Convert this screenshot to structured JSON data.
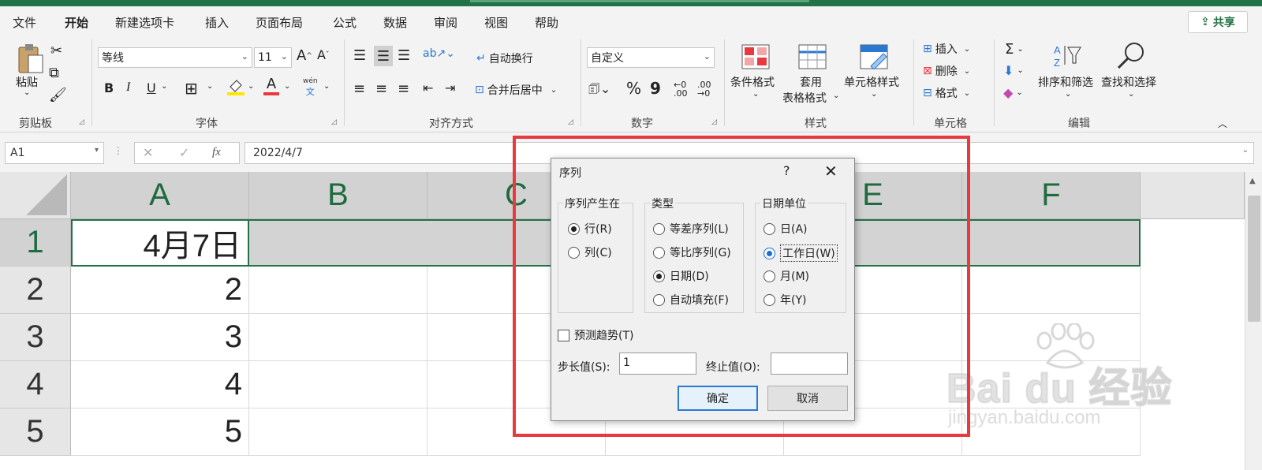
{
  "menu": {
    "items": [
      "文件",
      "开始",
      "新建选项卡",
      "插入",
      "页面布局",
      "公式",
      "数据",
      "审阅",
      "视图",
      "帮助"
    ],
    "share_label": "共享"
  },
  "ribbon": {
    "clipboard": {
      "paste": "粘贴",
      "group": "剪贴板"
    },
    "font": {
      "name": "等线",
      "size": "11",
      "group": "字体",
      "grow": "A",
      "shrink": "A",
      "bold": "B",
      "italic": "I",
      "underline": "U",
      "color_letter": "A",
      "phonetic": "wén",
      "phonetic_char": "文"
    },
    "align": {
      "wrap": "自动换行",
      "merge": "合并后居中",
      "group": "对齐方式",
      "rotate": "ab"
    },
    "number": {
      "format": "自定义",
      "group": "数字",
      "percent": "%",
      "comma": "9"
    },
    "styles": {
      "cond": "条件格式",
      "table1": "套用",
      "table2": "表格格式",
      "cell": "单元格样式",
      "group": "样式"
    },
    "cells": {
      "insert": "插入",
      "delete": "删除",
      "format": "格式",
      "group": "单元格"
    },
    "edit": {
      "sort": "排序和筛选",
      "find": "查找和选择",
      "group": "编辑",
      "sum": "Σ"
    }
  },
  "formula_bar": {
    "name_box": "A1",
    "fx": "fx",
    "value": "2022/4/7"
  },
  "sheet": {
    "columns": [
      "A",
      "B",
      "C",
      "D",
      "E",
      "F"
    ],
    "rows": [
      "1",
      "2",
      "3",
      "4",
      "5"
    ],
    "a_values": [
      "4月7日",
      "2",
      "3",
      "4",
      "5"
    ]
  },
  "dialog": {
    "title": "序列",
    "help": "?",
    "close": "✕",
    "series_in": {
      "legend": "序列产生在",
      "row": "行(R)",
      "col": "列(C)",
      "selected": "row"
    },
    "type": {
      "legend": "类型",
      "linear": "等差序列(L)",
      "growth": "等比序列(G)",
      "date": "日期(D)",
      "autofill": "自动填充(F)",
      "selected": "date"
    },
    "date_unit": {
      "legend": "日期单位",
      "day": "日(A)",
      "weekday": "工作日(W)",
      "month": "月(M)",
      "year": "年(Y)",
      "selected": "weekday"
    },
    "trend": "预测趋势(T)",
    "step_label": "步长值(S):",
    "step_value": "1",
    "stop_label": "终止值(O):",
    "stop_value": "",
    "ok": "确定",
    "cancel": "取消"
  },
  "watermark": {
    "logo": "Bai du 经验",
    "url": "jingyan.baidu.com"
  },
  "colors": {
    "excel_green": "#217346",
    "highlight_red": "#e8393f",
    "focus_blue": "#2b78d1"
  }
}
